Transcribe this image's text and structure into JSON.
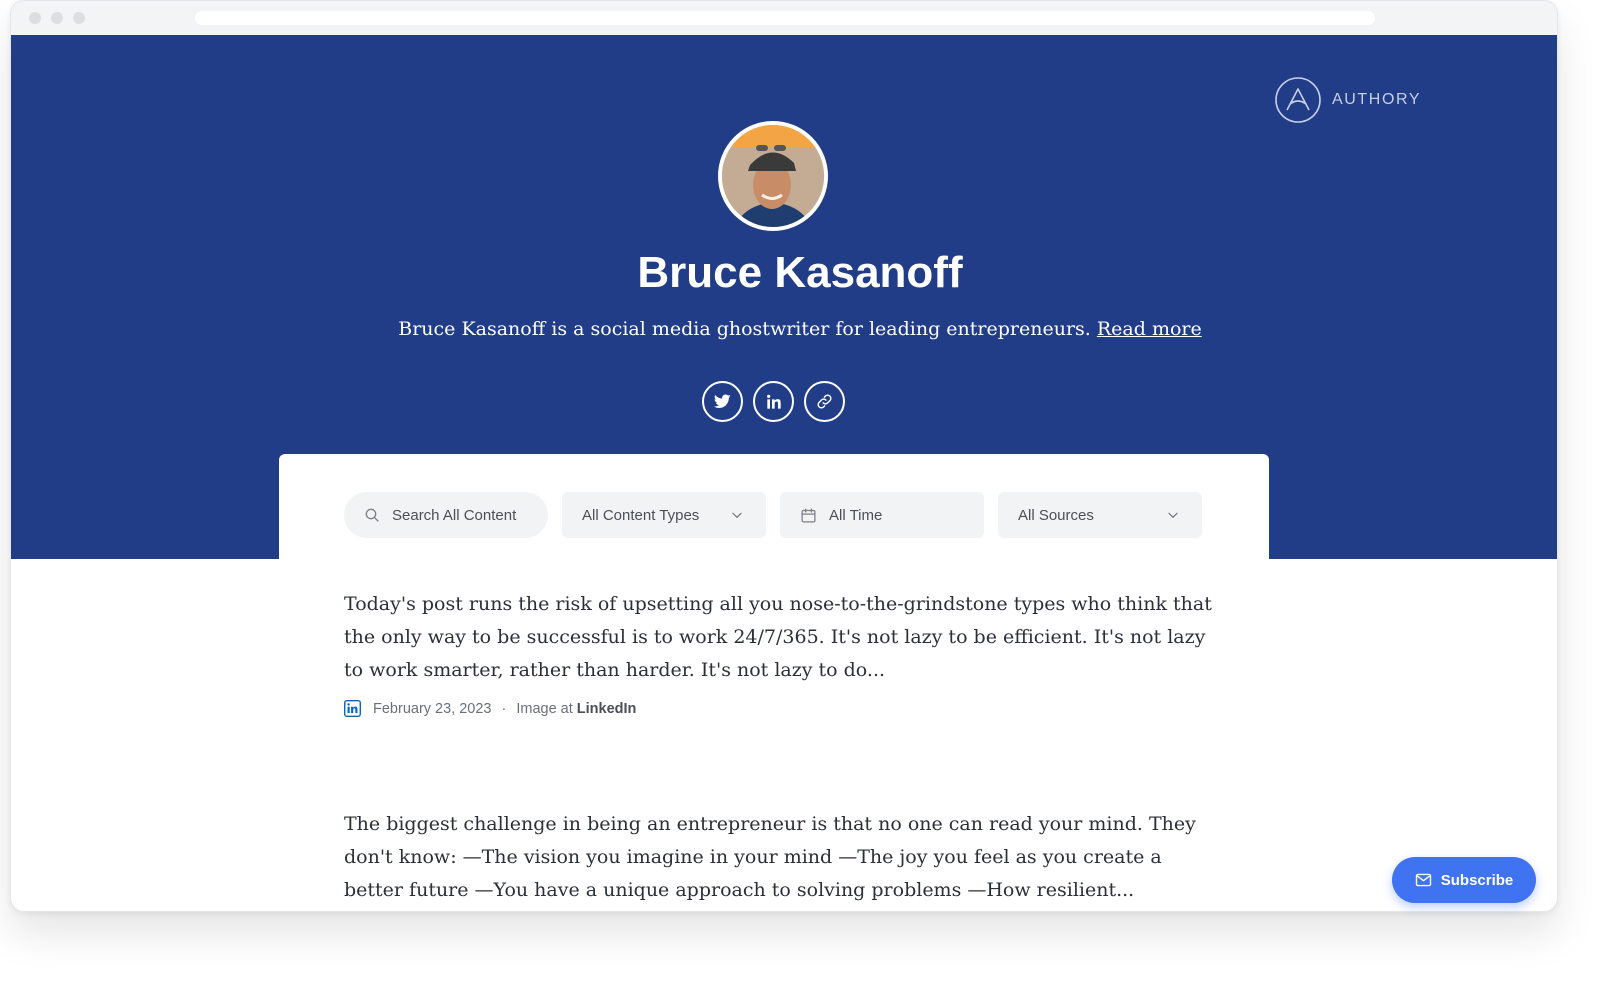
{
  "brand": {
    "name": "AUTHORY",
    "icon": "authory-logo-icon"
  },
  "profile": {
    "name": "Bruce Kasanoff",
    "bio": "Bruce Kasanoff is a social media ghostwriter for leading entrepreneurs.",
    "read_more": "Read more",
    "avatar": "avatar-photo",
    "socials": [
      {
        "icon": "twitter-icon"
      },
      {
        "icon": "linkedin-icon"
      },
      {
        "icon": "link-icon"
      }
    ]
  },
  "filters": {
    "search_placeholder": "Search All Content",
    "content_types": "All Content Types",
    "time": "All Time",
    "sources": "All Sources"
  },
  "posts": [
    {
      "text": "Today's post runs the risk of upsetting all you nose-to-the-grindstone types who think that the only way to be successful is to work 24/7/365. It's not lazy to be efficient. It's not lazy to work smarter, rather than harder. It's not lazy to do...",
      "date": "February 23, 2023",
      "separator": "·",
      "type_prefix": "Image at",
      "source": "LinkedIn",
      "source_icon": "linkedin-icon"
    },
    {
      "text": "The biggest challenge in being an entrepreneur is that no one can read your mind. They don't know: —The vision you imagine in your mind —The joy you feel as you create a better future —You have a unique approach to solving problems —How resilient..."
    }
  ],
  "subscribe": {
    "label": "Subscribe",
    "icon": "mail-icon"
  },
  "colors": {
    "hero": "#223d87",
    "accent": "#3f73f2",
    "linkedin": "#0a66c2"
  }
}
